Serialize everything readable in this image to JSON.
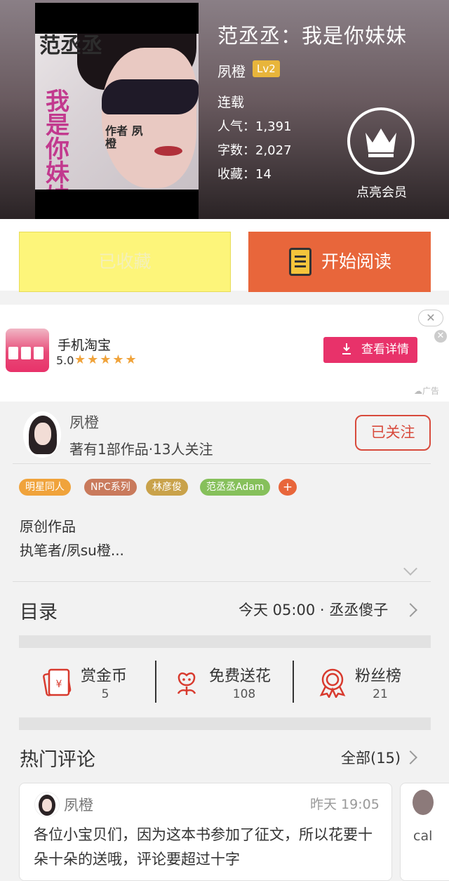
{
  "book": {
    "title": "范丞丞：我是你妹妹",
    "author": "夙橙",
    "level": "Lv2",
    "status": "连载",
    "popularity": "人气：1,391",
    "word_count": "字数：2,027",
    "favorites": "收藏：14",
    "cover_text_top": "范丞丞",
    "cover_text_main": "我是你妹妹",
    "cover_text_side": "作者 夙橙"
  },
  "member": {
    "label": "点亮会员"
  },
  "actions": {
    "collected_label": "已收藏",
    "read_label": "开始阅读"
  },
  "ad": {
    "app_name": "手机淘宝",
    "rating": "5.0",
    "stars": "★★★★★",
    "button": "查看详情",
    "close": "✕",
    "tag": "☁广告"
  },
  "author": {
    "name": "夙橙",
    "meta": "著有1部作品·13人关注",
    "follow_label": "已关注"
  },
  "tags": [
    {
      "label": "明星同人",
      "color": "#f0a33b"
    },
    {
      "label": "NPC系列",
      "color": "#c97a5c"
    },
    {
      "label": "林彦俊",
      "color": "#c9a24a"
    },
    {
      "label": "范丞丞Adam",
      "color": "#86c05b"
    }
  ],
  "tag_more": "+",
  "description": {
    "line1": "原创作品",
    "line2": "执笔者/夙su橙..."
  },
  "toc": {
    "title": "目录",
    "latest": "今天 05:00 · 丞丞傻子"
  },
  "rewards": [
    {
      "label": "赏金币",
      "value": "5",
      "icon": "red-envelope-icon"
    },
    {
      "label": "免费送花",
      "value": "108",
      "icon": "flower-icon"
    },
    {
      "label": "粉丝榜",
      "value": "21",
      "icon": "medal-icon"
    }
  ],
  "comments": {
    "title": "热门评论",
    "all_label": "全部(15)",
    "items": [
      {
        "user": "夙橙",
        "time": "昨天 19:05",
        "text": "各位小宝贝们，因为这本书参加了征文，所以花要十朵十朵的送哦，评论要超过十字"
      },
      {
        "text": "cal"
      }
    ]
  },
  "colors": {
    "accent": "#e8663b",
    "follow": "#d84a3c",
    "ad": "#e8326a",
    "collected": "#fdf57a"
  }
}
